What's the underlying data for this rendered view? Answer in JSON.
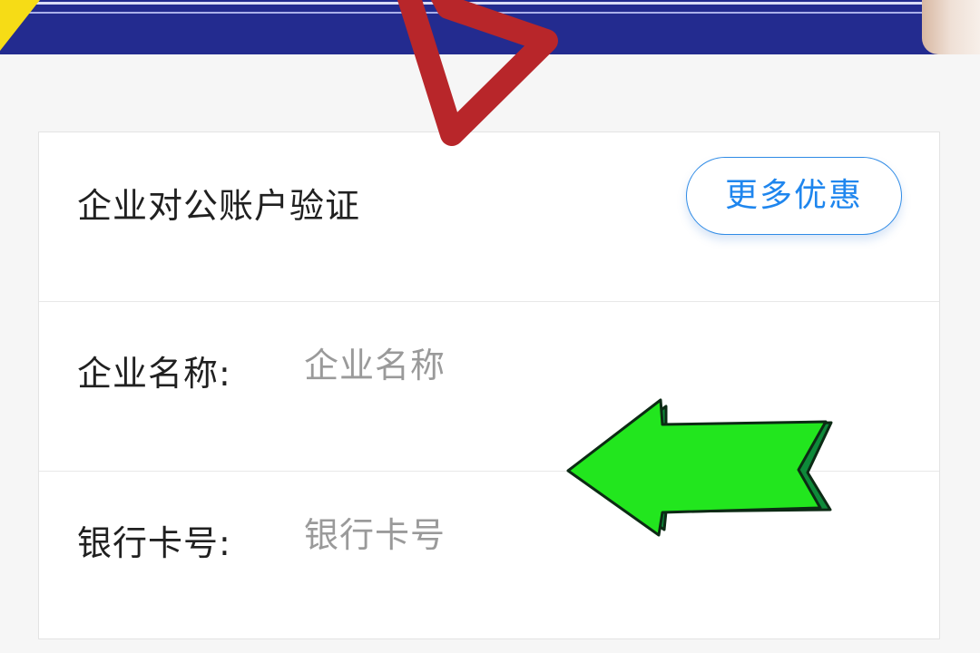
{
  "card": {
    "title": "企业对公账户验证",
    "more_button": "更多优惠"
  },
  "fields": {
    "company_name": {
      "label": "企业名称:",
      "placeholder": "企业名称",
      "value": ""
    },
    "bank_card": {
      "label": "银行卡号:",
      "placeholder": "银行卡号",
      "value": ""
    }
  },
  "annotations": {
    "red_arrow_color": "#b8262a",
    "green_arrow_color": "#22e61e",
    "green_arrow_shadow": "#0e8a3a"
  },
  "banner": {
    "background_color": "#232b8f"
  },
  "accent_color": "#1f86ee"
}
